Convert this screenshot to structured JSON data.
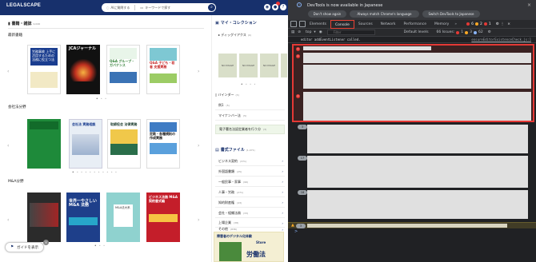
{
  "header": {
    "logo": "LEGALSCAPE",
    "logo_sub": "",
    "search_ai": "AIに質問する",
    "search_keyword": "キーワードで探す"
  },
  "books": {
    "title": "書籍・雑誌",
    "count": "9,046",
    "sections": [
      {
        "title": "最新書籍"
      },
      {
        "title": "会社法分野"
      },
      {
        "title": "M&A分野"
      }
    ],
    "covers": {
      "c1": "労務事故 上手に活用するための 法務に役立つ法",
      "c2": "JCAジャーナル",
      "c3": "Q&A グループ・ガバナンス",
      "c4": "Q&A 子ども・若者 支援実務",
      "c5": "会社法 実務相談",
      "c6": "取締役会 法律実務",
      "c7": "定款・各種規則の作成実務",
      "c8": "",
      "c9": "世界一やさしい M&A 法務",
      "c10": "M&A法大系",
      "c11": "ビジネス法務 M&A 契約書式編"
    },
    "guide_label": "ガイドを表示"
  },
  "my_collection": {
    "title": "マイ・コレクション",
    "dog_ear": "ディッグイアクス",
    "dog_ear_count": "(0)",
    "no_image": "NO IMAGE",
    "binder": "バインダー",
    "binder_count": "(3)",
    "binder_rows": [
      {
        "label": "例1",
        "count": "(5)"
      },
      {
        "label": "マイナンバー法",
        "count": "(5)"
      },
      {
        "label": "電子署名法認定業者を行う分",
        "count": "(3)"
      }
    ]
  },
  "forms": {
    "title": "書式ファイル",
    "count": "(1,071)",
    "rows": [
      {
        "label": "ビジネス契約",
        "count": "(371)"
      },
      {
        "label": "外国語書類",
        "count": "(25)"
      },
      {
        "label": "一般民事・家事",
        "count": "(96)"
      },
      {
        "label": "人事・労務",
        "count": "(271)"
      },
      {
        "label": "知的財産権",
        "count": "(43)"
      },
      {
        "label": "会社・組織法務",
        "count": "(33)"
      },
      {
        "label": "上場企業",
        "count": "(38)"
      },
      {
        "label": "その他",
        "count": "(836)"
      }
    ]
  },
  "ad": {
    "title": "障害者のデジタル化体験",
    "brand": "Store",
    "book": "労働法"
  },
  "devtools": {
    "notice": "DevTools is now available in Japanese",
    "btn_dont": "Don't show again",
    "btn_always": "Always match Chrome's language",
    "btn_switch": "Switch DevTools to Japanese",
    "tabs": [
      "Elements",
      "Console",
      "Sources",
      "Network",
      "Performance",
      "Memory"
    ],
    "tab_more": "»",
    "err_count": "6",
    "warn_count": "2",
    "info_count": "1",
    "top": "top",
    "filter": "Filter",
    "levels": "Default levels",
    "issues": "66 Issues:",
    "issue_err": "1",
    "issue_warn": "3",
    "issue_info": "62",
    "log": "editor addEventListener called.",
    "log_src": "ensureEditorExistenceCheck.js:1",
    "counts": [
      "3",
      "17",
      "18",
      "3"
    ],
    "prompt": ">"
  },
  "colors": {
    "brand": "#17306c",
    "error": "#e53935",
    "devtools_bg": "#202124"
  }
}
